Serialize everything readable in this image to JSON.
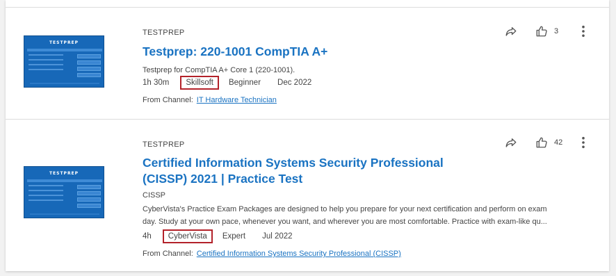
{
  "courses": [
    {
      "provider": "TESTPREP",
      "title_lines": [
        "Testprep: 220-1001 CompTIA A+"
      ],
      "subtitle": "",
      "description": "Testprep for CompTIA A+ Core 1 (220-1001).",
      "duration": "1h 30m",
      "source": "Skillsoft",
      "level": "Beginner",
      "date": "Dec 2022",
      "channel_label": "From Channel:",
      "channel_name": "IT Hardware Technician",
      "likes": "3",
      "thumbnail_brand": "TESTPREP"
    },
    {
      "provider": "TESTPREP",
      "title_lines": [
        "Certified Information Systems Security Professional",
        "(CISSP) 2021 | Practice Test"
      ],
      "subtitle": "CISSP",
      "description_lines": [
        "CyberVista's Practice Exam Packages are designed to help you prepare for your next certification and perform on exam",
        "day. Study at your own pace, whenever you want, and wherever you are most comfortable. Practice with exam-like qu..."
      ],
      "duration": "4h",
      "source": "CyberVista",
      "level": "Expert",
      "date": "Jul 2022",
      "channel_label": "From Channel:",
      "channel_name": "Certified Information Systems Security Professional (CISSP)",
      "likes": "42",
      "thumbnail_brand": "TESTPREP"
    }
  ],
  "icons": {
    "share": "share-icon",
    "like": "thumbs-up-icon",
    "more": "more-vertical-icon"
  },
  "colors": {
    "link": "#1a73c2",
    "highlight_box": "#b3222a",
    "thumbnail": "#1768b8"
  }
}
